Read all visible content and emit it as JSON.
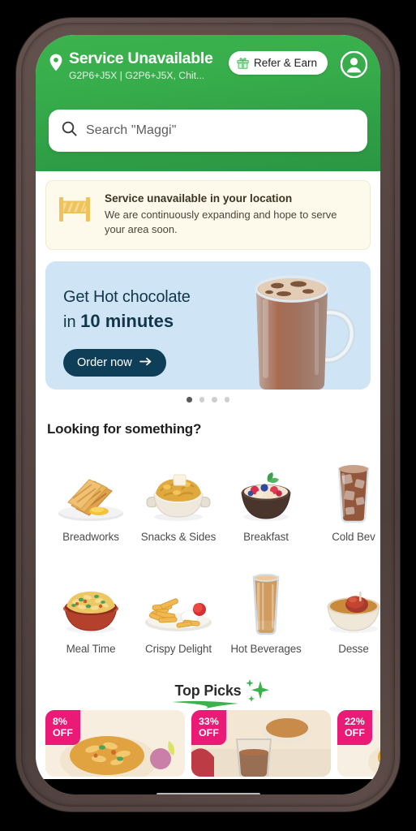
{
  "header": {
    "location_icon": "map-pin-icon",
    "title": "Service Unavailable",
    "subtitle": "G2P6+J5X | G2P6+J5X, Chit...",
    "refer_label": "Refer & Earn",
    "refer_icon": "gift-icon",
    "profile_icon": "user-avatar-icon",
    "brand_green": "#34a94a"
  },
  "search": {
    "icon": "search-icon",
    "placeholder": "Search \"Maggi\"",
    "value": ""
  },
  "alert": {
    "icon": "barricade-icon",
    "title": "Service unavailable in your location",
    "description": "We are continuously expanding and hope to serve your area soon.",
    "bg": "#fdfaec",
    "icon_color": "#e8b94a"
  },
  "promo": {
    "line1": "Get Hot chocolate",
    "line2_prefix": "in ",
    "line2_strong": "10 minutes",
    "cta_label": "Order now",
    "cta_icon": "arrow-right-icon",
    "image": "hot-chocolate-mug",
    "bg": "#cfe5f5",
    "cta_bg": "#0f3f58",
    "dots_total": 4,
    "dots_active": 1
  },
  "categories": {
    "section_title": "Looking for something?",
    "row1": [
      {
        "label": "Breadworks",
        "art": "grilled-sandwich"
      },
      {
        "label": "Snacks & Sides",
        "art": "noodle-bowl"
      },
      {
        "label": "Breakfast",
        "art": "fruit-cereal-bowl"
      },
      {
        "label": "Cold Bev",
        "art": "iced-cola-glass"
      }
    ],
    "row2": [
      {
        "label": "Meal Time",
        "art": "biryani-bowl"
      },
      {
        "label": "Crispy Delight",
        "art": "fries-plate"
      },
      {
        "label": "Hot Beverages",
        "art": "chai-glass"
      },
      {
        "label": "Desse",
        "art": "dessert-bowl"
      }
    ]
  },
  "top_picks": {
    "title": "Top Picks",
    "sparkle_icon": "sparkles-icon",
    "underline_color": "#3cb24e",
    "cards": [
      {
        "discount_pct": "8%",
        "discount_suffix": "OFF",
        "art": "biryani-plate"
      },
      {
        "discount_pct": "33%",
        "discount_suffix": "OFF",
        "art": "tea-glass"
      },
      {
        "discount_pct": "22%",
        "discount_suffix": "OFF",
        "art": "noodles-plate"
      }
    ],
    "badge_color": "#ea1a76"
  },
  "system": {
    "home_indicator": "home-indicator"
  }
}
